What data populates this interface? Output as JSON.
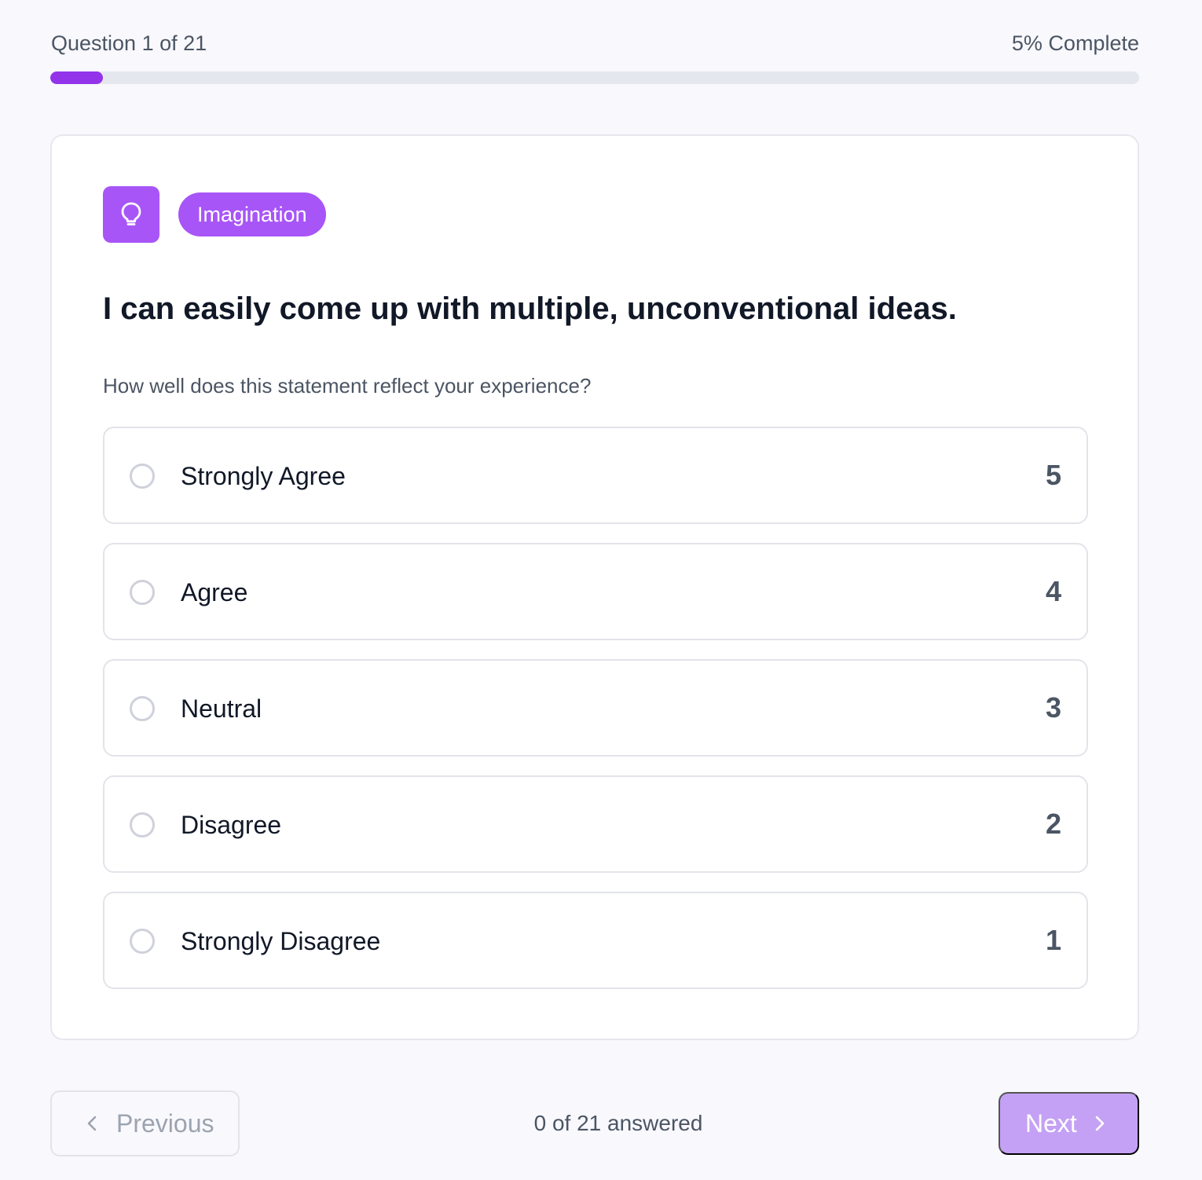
{
  "progress": {
    "question_label": "Question 1 of 21",
    "complete_label": "5% Complete",
    "fraction": 0.048
  },
  "category": {
    "icon": "lightbulb-icon",
    "label": "Imagination"
  },
  "question": {
    "text": "I can easily come up with multiple, unconventional ideas.",
    "prompt": "How well does this statement reflect your experience?"
  },
  "options": [
    {
      "label": "Strongly Agree",
      "value": "5"
    },
    {
      "label": "Agree",
      "value": "4"
    },
    {
      "label": "Neutral",
      "value": "3"
    },
    {
      "label": "Disagree",
      "value": "2"
    },
    {
      "label": "Strongly Disagree",
      "value": "1"
    }
  ],
  "footer": {
    "previous_label": "Previous",
    "answered_label": "0 of 21 answered",
    "next_label": "Next"
  },
  "colors": {
    "accent": "#9333ea",
    "accent_icon": "#a855f7",
    "next_disabled": "#c4a1f4",
    "track": "#e5e7ef"
  }
}
